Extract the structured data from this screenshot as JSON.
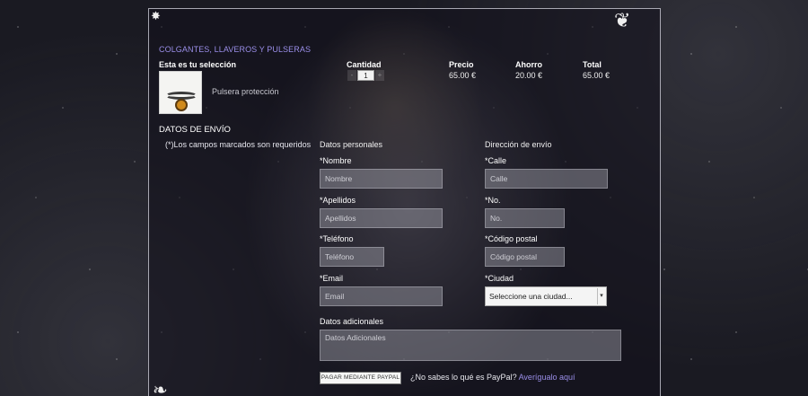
{
  "category": "COLGANTES, LLAVEROS Y PULSERAS",
  "cart": {
    "heading": "Esta es tu selección",
    "columns": {
      "quantity": "Cantidad",
      "price": "Precio",
      "saving": "Ahorro",
      "total": "Total"
    },
    "item": {
      "name": "Pulsera protección",
      "quantity": "1",
      "price": "65.00 €",
      "saving": "20.00 €",
      "total": "65.00 €"
    },
    "minus": "-",
    "plus": "+"
  },
  "shipping": {
    "title": "DATOS DE ENVÍO",
    "required_note": "(*)Los campos marcados son requeridos",
    "personal": {
      "title": "Datos personales",
      "name": {
        "label": "*Nombre",
        "placeholder": "Nombre"
      },
      "surname": {
        "label": "*Apellidos",
        "placeholder": "Apellidos"
      },
      "phone": {
        "label": "*Teléfono",
        "placeholder": "Teléfono"
      },
      "email": {
        "label": "*Email",
        "placeholder": "Email"
      }
    },
    "address": {
      "title": "Dirección de envío",
      "street": {
        "label": "*Calle",
        "placeholder": "Calle"
      },
      "number": {
        "label": "*No.",
        "placeholder": "No."
      },
      "postal": {
        "label": "*Código postal",
        "placeholder": "Código postal"
      },
      "city": {
        "label": "*Ciudad",
        "selected": "Seleccione una ciudad..."
      }
    },
    "extra": {
      "label": "Datos adicionales",
      "placeholder": "Datos Adicionales"
    }
  },
  "payment": {
    "button": "PAGAR MEDIANTE PAYPAL",
    "question": "¿No sabes lo qué es PayPal?",
    "link": "Averígualo aquí"
  },
  "icons": {
    "corner": "star-icon",
    "ornament": "ornament-icon"
  }
}
